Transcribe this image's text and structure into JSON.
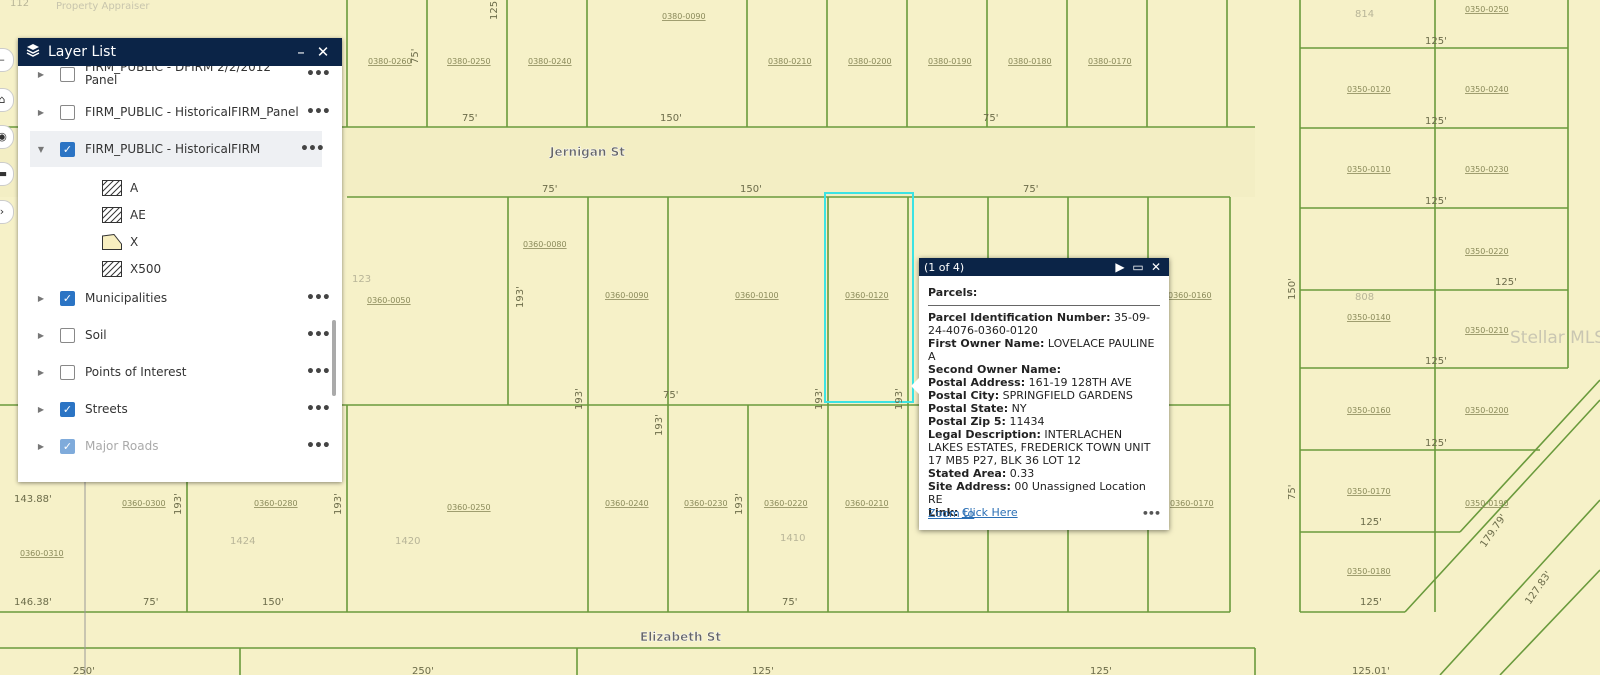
{
  "map": {
    "streets": [
      "Jernigan St",
      "Elizabeth St"
    ],
    "parcels": [
      "0380-0260",
      "0380-0250",
      "0380-0240",
      "0380-0090",
      "0380-0210",
      "0380-0200",
      "0380-0190",
      "0380-0180",
      "0380-0170",
      "0360-0080",
      "0360-0050",
      "0360-0090",
      "0360-0100",
      "0360-0120",
      "0360-0160",
      "0360-0300",
      "0360-0280",
      "0360-0250",
      "0360-0240",
      "0360-0230",
      "0360-0220",
      "0360-0210",
      "0360-0170",
      "0360-0310",
      "0350-0250",
      "0350-0120",
      "0350-0240",
      "0350-0110",
      "0350-0230",
      "0350-0220",
      "0350-0140",
      "0350-0210",
      "0350-0160",
      "0350-0200",
      "0350-0170",
      "0350-0190",
      "0350-0180"
    ],
    "dims": [
      "75'",
      "150'",
      "75'",
      "75'",
      "150'",
      "75'",
      "193'",
      "193'",
      "193'",
      "193'",
      "193'",
      "193'",
      "193'",
      "193'",
      "125'",
      "125'",
      "125'",
      "125'",
      "125'",
      "125'",
      "125'",
      "125'",
      "125'",
      "150'",
      "75'",
      "179.79'",
      "127.83'",
      "143.88'",
      "146.38'",
      "75'",
      "150'",
      "75'",
      "250'",
      "250'",
      "125'",
      "125'",
      "125.01'",
      "75'",
      "75'"
    ],
    "lots": [
      "123",
      "1424",
      "1420",
      "1410",
      "808",
      "814",
      "112"
    ],
    "watermark": "Stellar MLS",
    "top_faint": "Property Appraiser"
  },
  "layer_list": {
    "title": "Layer List",
    "minimize": "–",
    "close": "✕",
    "rows": [
      {
        "label": "FIRM_PUBLIC - DFIRM 2/2/2012 Panel",
        "checked": false
      },
      {
        "label": "FIRM_PUBLIC - HistoricalFIRM_Panel",
        "checked": false
      },
      {
        "label": "FIRM_PUBLIC - HistoricalFIRM",
        "checked": true
      },
      {
        "label": "Municipalities",
        "checked": true
      },
      {
        "label": "Soil",
        "checked": false
      },
      {
        "label": "Points of Interest",
        "checked": false
      },
      {
        "label": "Streets",
        "checked": true
      },
      {
        "label": "Major Roads",
        "checked": true
      }
    ],
    "legend": [
      {
        "label": "A",
        "fill": "hatch"
      },
      {
        "label": "AE",
        "fill": "hatch"
      },
      {
        "label": "X",
        "fill": "#f7eec0"
      },
      {
        "label": "X500",
        "fill": "hatch"
      }
    ],
    "more": "•••"
  },
  "popup": {
    "count": "(1 of 4)",
    "title": "Parcels:",
    "fields": [
      {
        "k": "Parcel Identification Number:",
        "v": "35-09-24-4076-0360-0120"
      },
      {
        "k": "First Owner Name:",
        "v": "LOVELACE PAULINE A"
      },
      {
        "k": "Second Owner Name:",
        "v": ""
      },
      {
        "k": "Postal Address:",
        "v": "161-19 128TH AVE"
      },
      {
        "k": "Postal City:",
        "v": "SPRINGFIELD GARDENS"
      },
      {
        "k": "Postal State:",
        "v": "NY"
      },
      {
        "k": "Postal Zip 5:",
        "v": "11434"
      },
      {
        "k": "Legal Description:",
        "v": "INTERLACHEN LAKES ESTATES, FREDERICK TOWN UNIT 17 MB5 P27, BLK 36 LOT 12"
      },
      {
        "k": "Stated Area:",
        "v": "0.33"
      },
      {
        "k": "Site Address:",
        "v": "00 Unassigned Location RE"
      }
    ],
    "link_label": "Link:",
    "link_text": "Click Here",
    "zoom": "Zoom to",
    "more": "•••"
  }
}
